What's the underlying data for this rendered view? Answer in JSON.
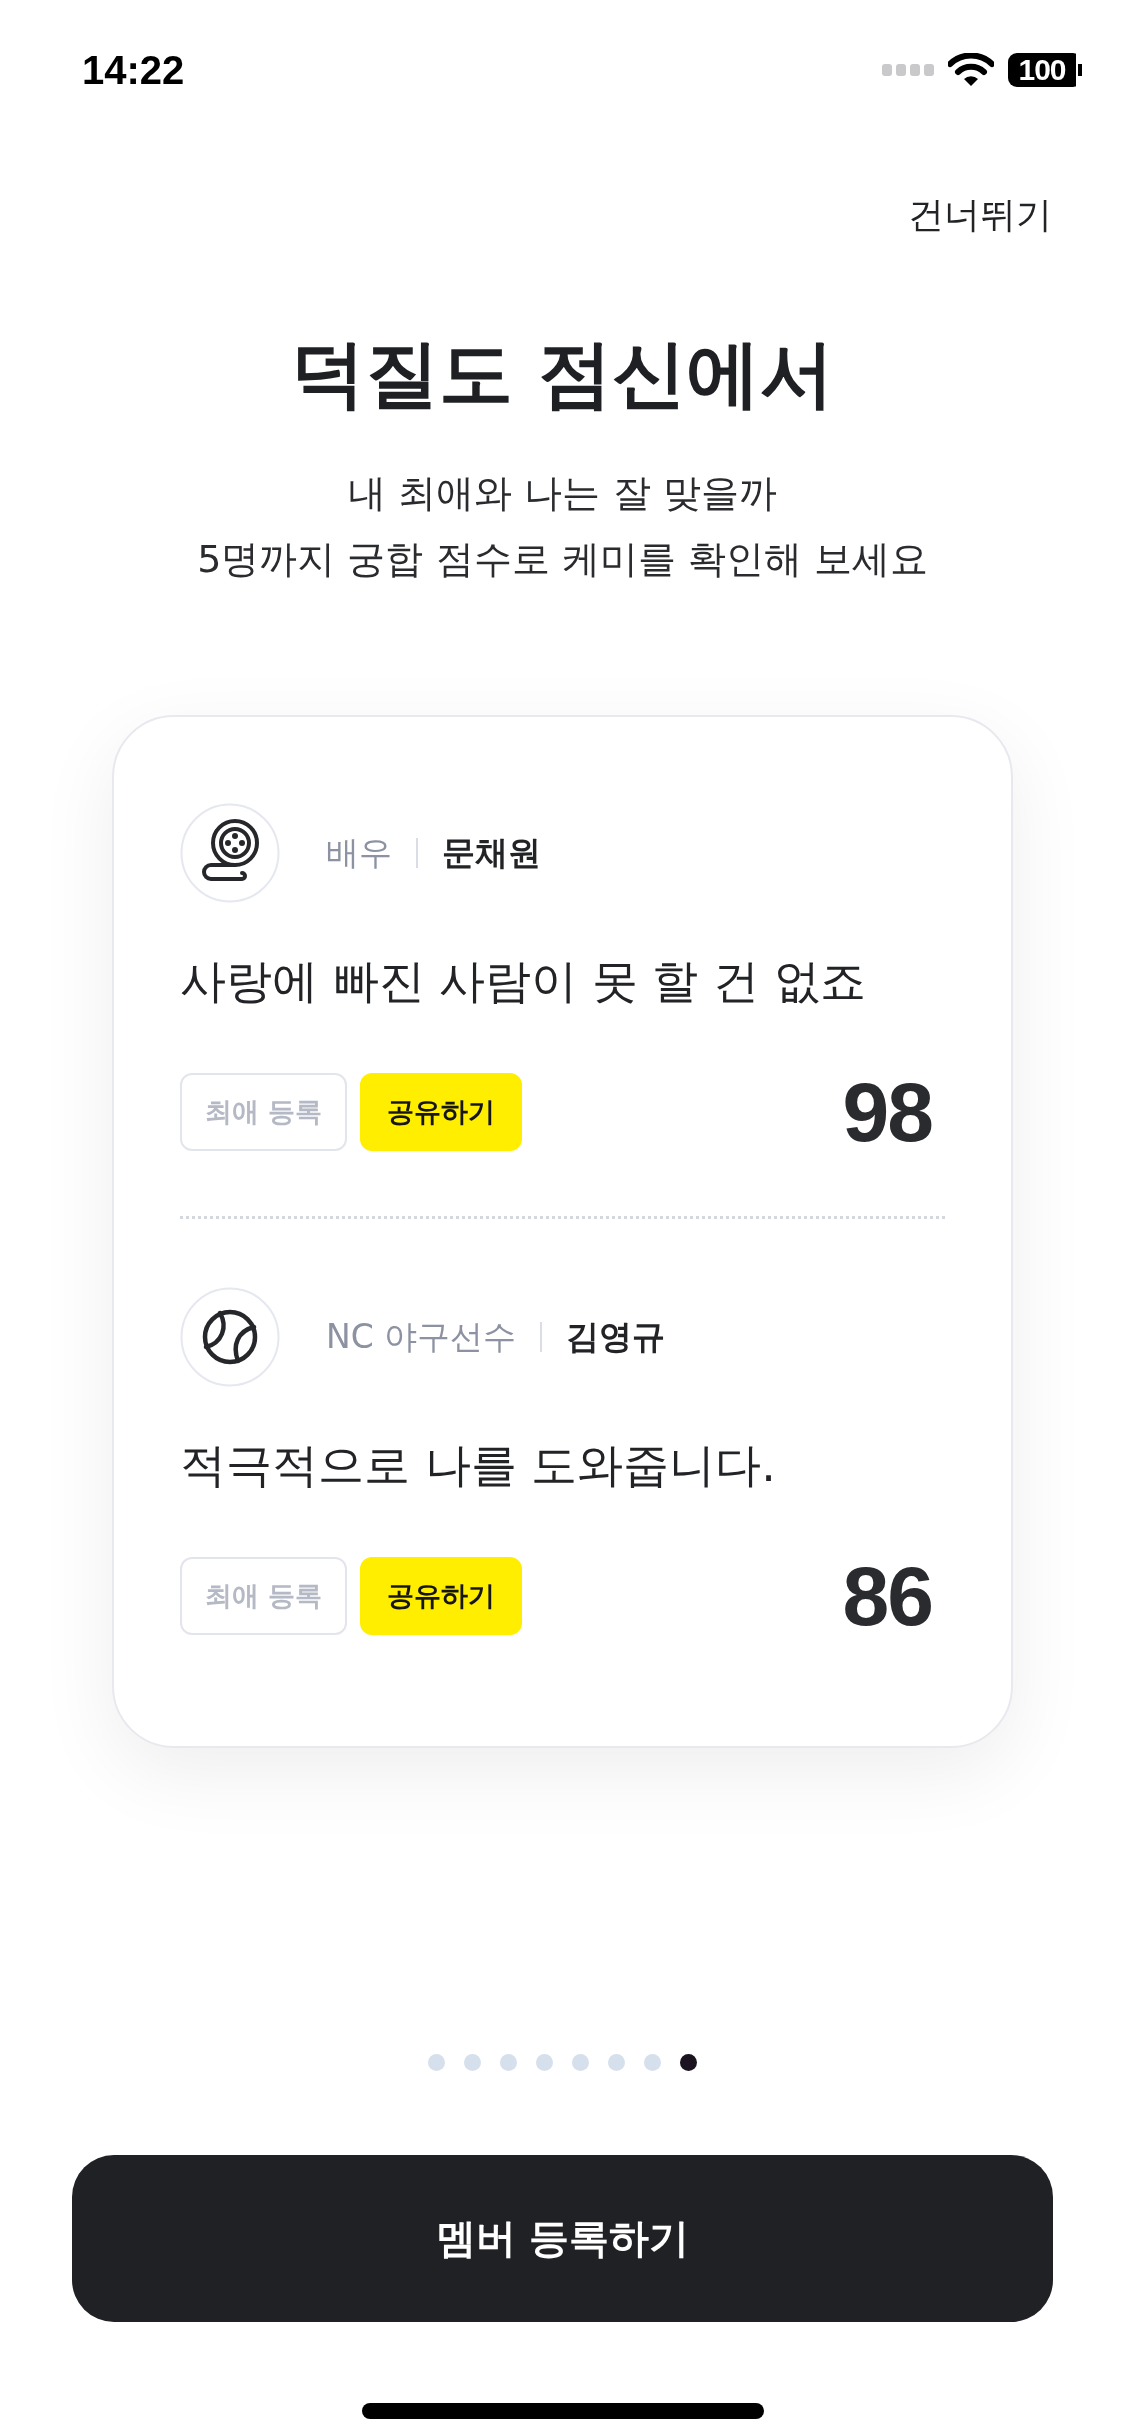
{
  "status_bar": {
    "time": "14:22",
    "battery": "100"
  },
  "skip": "건너뛰기",
  "title": "덕질도 점신에서",
  "subtitle": [
    "내 최애와 나는 잘 맞을까",
    "5명까지 궁합 점수로 케미를 확인해 보세요"
  ],
  "matches": [
    {
      "kind": "film",
      "role": "배우",
      "name": "문채원",
      "quote": "사랑에 빠진 사람이 못 할 건 없죠",
      "actions": [
        {
          "label": "최애 등록",
          "kind": "outline"
        },
        {
          "label": "공유하기",
          "kind": "primary"
        }
      ],
      "score": "98"
    },
    {
      "kind": "baseball",
      "role": "NC 야구선수",
      "name": "김영규",
      "quote": "적극적으로 나를 도와줍니다.",
      "actions": [
        {
          "label": "최애 등록",
          "kind": "outline"
        },
        {
          "label": "공유하기",
          "kind": "primary"
        }
      ],
      "score": "86"
    }
  ],
  "pagination": [
    {
      "selected": false
    },
    {
      "selected": false
    },
    {
      "selected": false
    },
    {
      "selected": false
    },
    {
      "selected": false
    },
    {
      "selected": false
    },
    {
      "selected": false
    },
    {
      "selected": true
    }
  ],
  "cta": "멤버 등록하기"
}
